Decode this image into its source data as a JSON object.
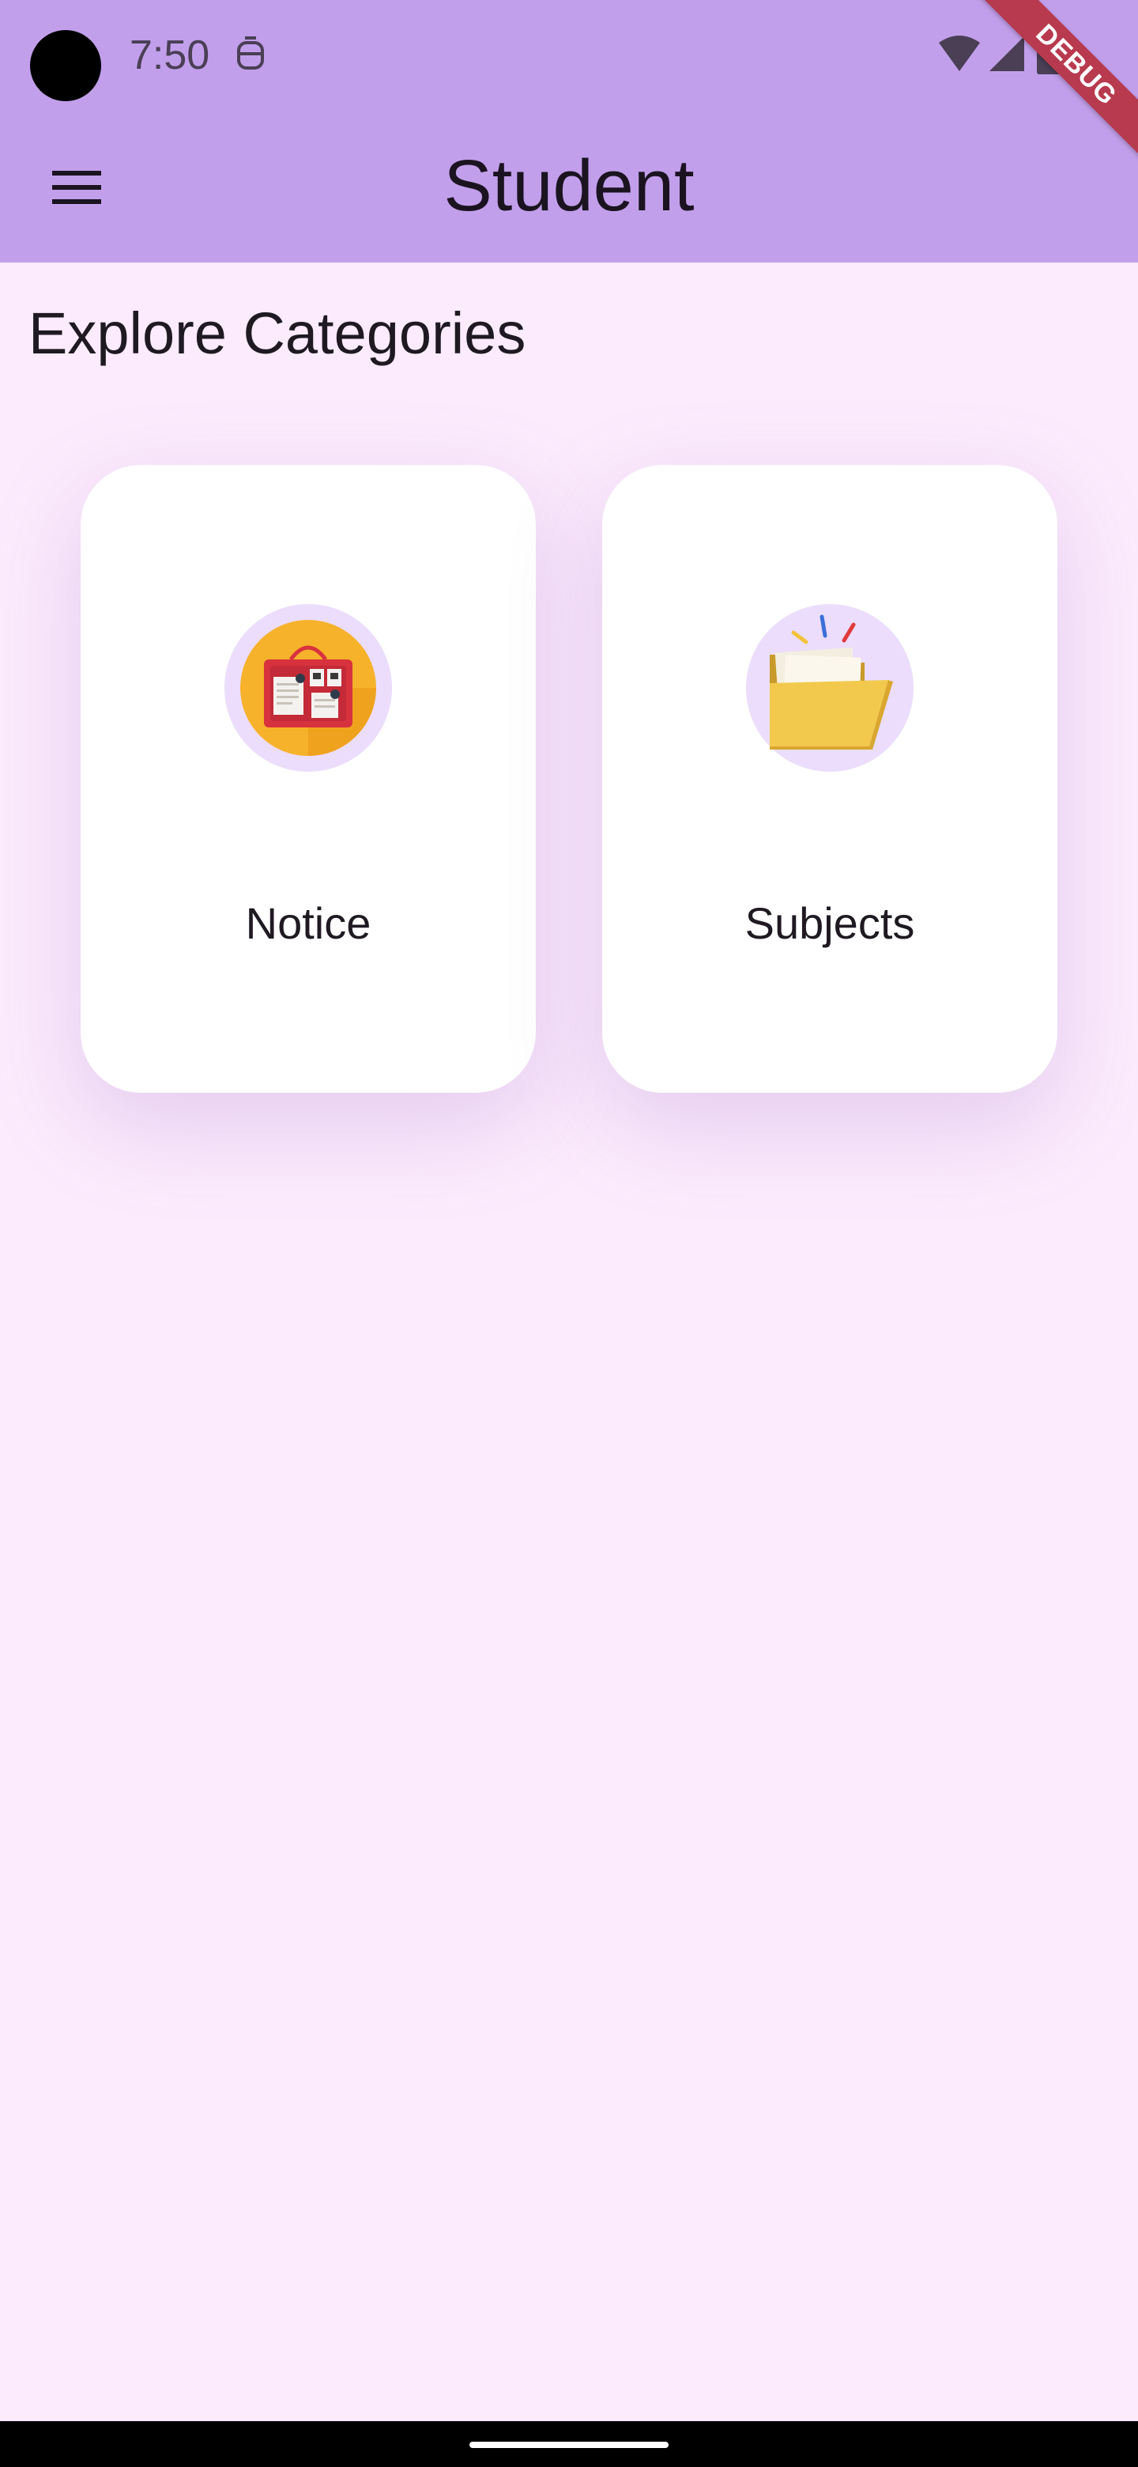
{
  "status_bar": {
    "time": "7:50"
  },
  "app_bar": {
    "title": "Student",
    "menu_icon": "menu-icon"
  },
  "debug_banner": {
    "label": "DEBUG"
  },
  "main": {
    "heading": "Explore Categories",
    "categories": [
      {
        "label": "Notice",
        "icon": "notice-board-icon"
      },
      {
        "label": "Subjects",
        "icon": "folder-icon"
      }
    ]
  },
  "colors": {
    "app_bar": "#C29FEB",
    "background": "#FCEBFD",
    "card": "#FFFFFF",
    "icon_circle": "#EBDDFB",
    "debug_ribbon": "#B83A4E"
  }
}
